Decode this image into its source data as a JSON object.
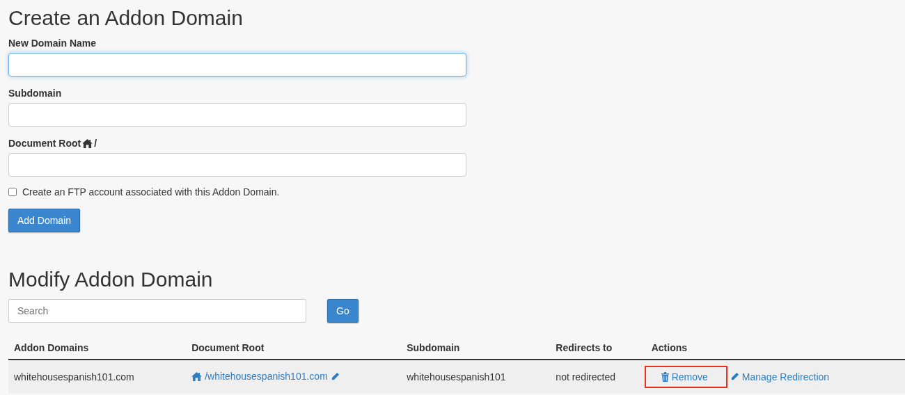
{
  "create_form": {
    "title": "Create an Addon Domain",
    "fields": [
      {
        "label": "New Domain Name",
        "focused": true,
        "home_icon": false
      },
      {
        "label": "Subdomain",
        "focused": false,
        "home_icon": false
      },
      {
        "label": "Document Root",
        "focused": false,
        "home_icon": true,
        "suffix": "/"
      }
    ],
    "ftp_checkbox": {
      "label": "Create an FTP account associated with this Addon Domain.",
      "checked": false
    },
    "submit_button": "Add Domain"
  },
  "modify": {
    "title": "Modify Addon Domain",
    "search": {
      "placeholder": "Search"
    },
    "go_button": "Go",
    "table": {
      "columns": [
        "Addon Domains",
        "Document Root",
        "Subdomain",
        "Redirects to",
        "Actions"
      ],
      "rows": [
        {
          "domain": "whitehousespanish101.com",
          "document_root": "/whitehousespanish101.com",
          "subdomain": "whitehousespanish101",
          "redirects_to": "not redirected",
          "actions": [
            {
              "kind": "remove",
              "label": "Remove",
              "highlighted": true
            },
            {
              "kind": "redirect",
              "label": "Manage Redirection",
              "highlighted": false
            }
          ]
        }
      ]
    }
  }
}
